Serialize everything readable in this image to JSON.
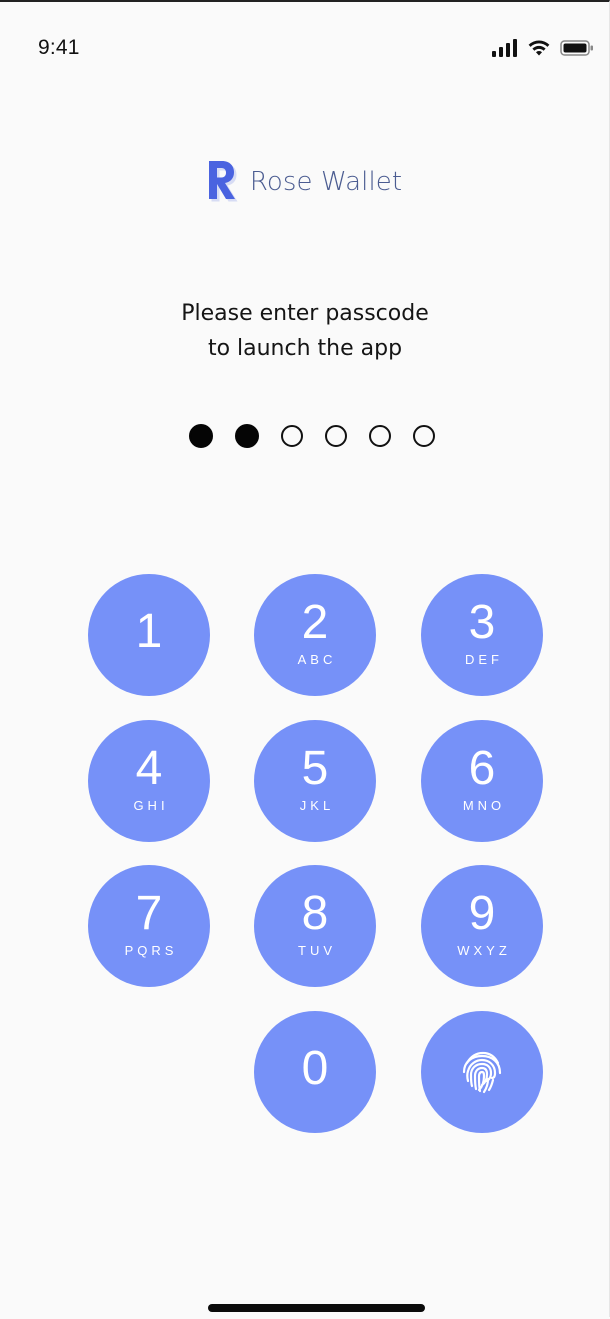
{
  "status_bar": {
    "time": "9:41"
  },
  "brand": {
    "logo_letter": "R",
    "name": "Rose Wallet",
    "accent_color": "#4a63e0"
  },
  "prompt": {
    "line1": "Please enter passcode",
    "line2": "to launch the app"
  },
  "passcode": {
    "length": 6,
    "entered": 2
  },
  "keypad": {
    "key_color": "#7691f8",
    "keys": [
      {
        "digit": "1",
        "letters": ""
      },
      {
        "digit": "2",
        "letters": "ABC"
      },
      {
        "digit": "3",
        "letters": "DEF"
      },
      {
        "digit": "4",
        "letters": "GHI"
      },
      {
        "digit": "5",
        "letters": "JKL"
      },
      {
        "digit": "6",
        "letters": "MNO"
      },
      {
        "digit": "7",
        "letters": "PQRS"
      },
      {
        "digit": "8",
        "letters": "TUV"
      },
      {
        "digit": "9",
        "letters": "WXYZ"
      },
      {
        "digit": "0",
        "letters": ""
      }
    ],
    "biometric_icon": "fingerprint-icon"
  }
}
